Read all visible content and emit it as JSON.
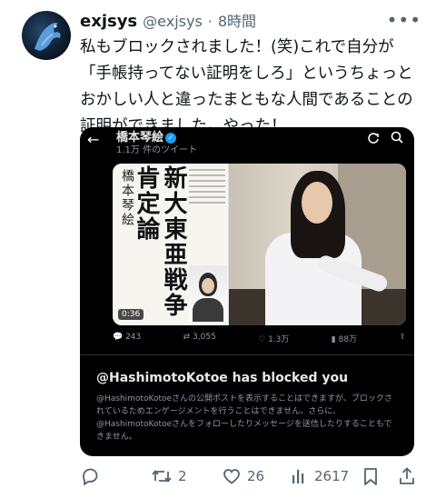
{
  "author": {
    "display_name": "exjsys",
    "handle": "@exjsys",
    "separator": "·",
    "timestamp": "8時間"
  },
  "tweet": {
    "lines": [
      "私もブロックされました！(笑)これで自分が",
      "「手帳持ってない証明をしろ」というちょっと",
      "おかしい人と違ったまともな人間であることの",
      "証明ができました。やった！"
    ]
  },
  "card": {
    "account_name": "橋本琴絵",
    "tweet_count": "1.1万 件のツイート",
    "book_author": "橋本琴絵",
    "book_title": "新大東亜戦争肯定論",
    "video_duration": "0:36",
    "stats": {
      "replies": "243",
      "retweets": "3,055",
      "likes": "1.3万",
      "views": "88万"
    },
    "blocked_title": "@HashimotoKotoe has blocked you",
    "blocked_lines": [
      "@HashimotoKotoeさんの公開ポストを表示することはできますが、ブロックさ",
      "れているためエンゲージメントを行うことはできません。さらに、",
      "@HashimotoKotoeさんをフォローしたりメッセージを送信したりすることもで",
      "きません。"
    ]
  },
  "actions": {
    "retweets": "2",
    "likes": "26",
    "views": "2617"
  },
  "icons": {
    "verified": "verified-badge-icon",
    "colors": {
      "accent": "#1d9bf0",
      "muted": "#536471",
      "card_bg": "#000000"
    }
  }
}
